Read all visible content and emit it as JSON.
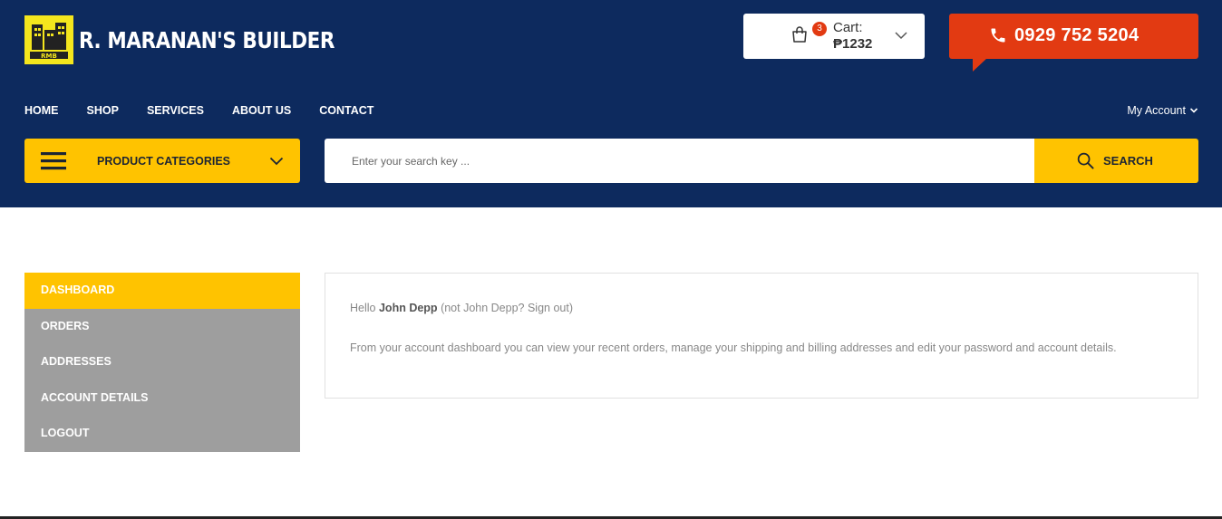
{
  "brand": {
    "name": "R. MARANAN'S BUILDER",
    "logo_text": "RMB",
    "logo_color": "#f4e61d"
  },
  "colors": {
    "header_bg": "#0d2a5e",
    "accent_yellow": "#ffc300",
    "accent_red": "#e23a12",
    "menu_gray": "#9e9e9e"
  },
  "cart": {
    "count": "3",
    "label": "Cart:",
    "total": "₱1232",
    "icon": "shopping-bag-icon"
  },
  "phone": {
    "number": "0929 752 5204",
    "icon": "phone-icon"
  },
  "nav": {
    "items": [
      "HOME",
      "SHOP",
      "SERVICES",
      "ABOUT US",
      "CONTACT"
    ],
    "account_label": "My Account"
  },
  "categories": {
    "label": "PRODUCT CATEGORIES"
  },
  "search": {
    "placeholder": "Enter your search key ...",
    "button_label": "SEARCH"
  },
  "account_menu": {
    "items": [
      "DASHBOARD",
      "ORDERS",
      "ADDRESSES",
      "ACCOUNT DETAILS",
      "LOGOUT"
    ],
    "active": "DASHBOARD"
  },
  "dashboard": {
    "hello_prefix": "Hello",
    "user_name": "John Depp",
    "not_you_text": "(not John Depp? Sign out)",
    "description": "From your account dashboard you can view your recent orders, manage your shipping and billing addresses and edit your password and account details."
  }
}
